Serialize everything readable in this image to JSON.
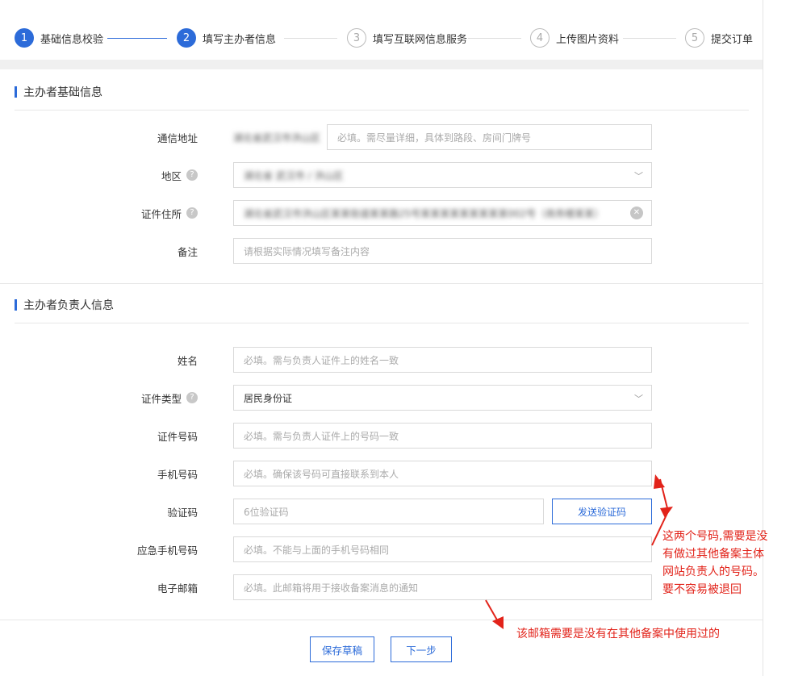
{
  "stepper": {
    "steps": [
      {
        "num": "1",
        "label": "基础信息校验"
      },
      {
        "num": "2",
        "label": "填写主办者信息"
      },
      {
        "num": "3",
        "label": "填写互联网信息服务"
      },
      {
        "num": "4",
        "label": "上传图片资料"
      },
      {
        "num": "5",
        "label": "提交订单"
      }
    ]
  },
  "sponsor_basic": {
    "title": "主办者基础信息",
    "address": {
      "label": "通信地址",
      "prefix": "湖北省武汉市洪山区",
      "placeholder": "必填。需尽量详细，具体到路段、房间门牌号"
    },
    "region": {
      "label": "地区",
      "value": "湖北省 武汉市 / 洪山区",
      "help": "?"
    },
    "id_address": {
      "label": "证件住所",
      "value": "湖北省武汉市洪山区某某街道某某路25号某某某某某某某某某002号（商务楼某某）",
      "help": "?"
    },
    "remarks": {
      "label": "备注",
      "placeholder": "请根据实际情况填写备注内容"
    }
  },
  "sponsor_owner": {
    "title": "主办者负责人信息",
    "name": {
      "label": "姓名",
      "placeholder": "必填。需与负责人证件上的姓名一致"
    },
    "id_type": {
      "label": "证件类型",
      "value": "居民身份证",
      "help": "?"
    },
    "id_number": {
      "label": "证件号码",
      "placeholder": "必填。需与负责人证件上的号码一致"
    },
    "mobile": {
      "label": "手机号码",
      "placeholder": "必填。确保该号码可直接联系到本人"
    },
    "code": {
      "label": "验证码",
      "placeholder": "6位验证码",
      "button": "发送验证码"
    },
    "emergency": {
      "label": "应急手机号码",
      "placeholder": "必填。不能与上面的手机号码相同"
    },
    "email": {
      "label": "电子邮箱",
      "placeholder": "必填。此邮箱将用于接收备案消息的通知"
    }
  },
  "actions": {
    "save": "保存草稿",
    "next": "下一步"
  },
  "annotations": {
    "phone_note_lines": [
      "这两个号码,需要是没",
      "有做过其他备案主体",
      "网站负责人的号码。",
      "要不容易被退回"
    ],
    "email_note": "该邮箱需要是没有在其他备案中使用过的"
  },
  "colors": {
    "accent": "#2c6bd9",
    "annotation": "#e2231a"
  }
}
